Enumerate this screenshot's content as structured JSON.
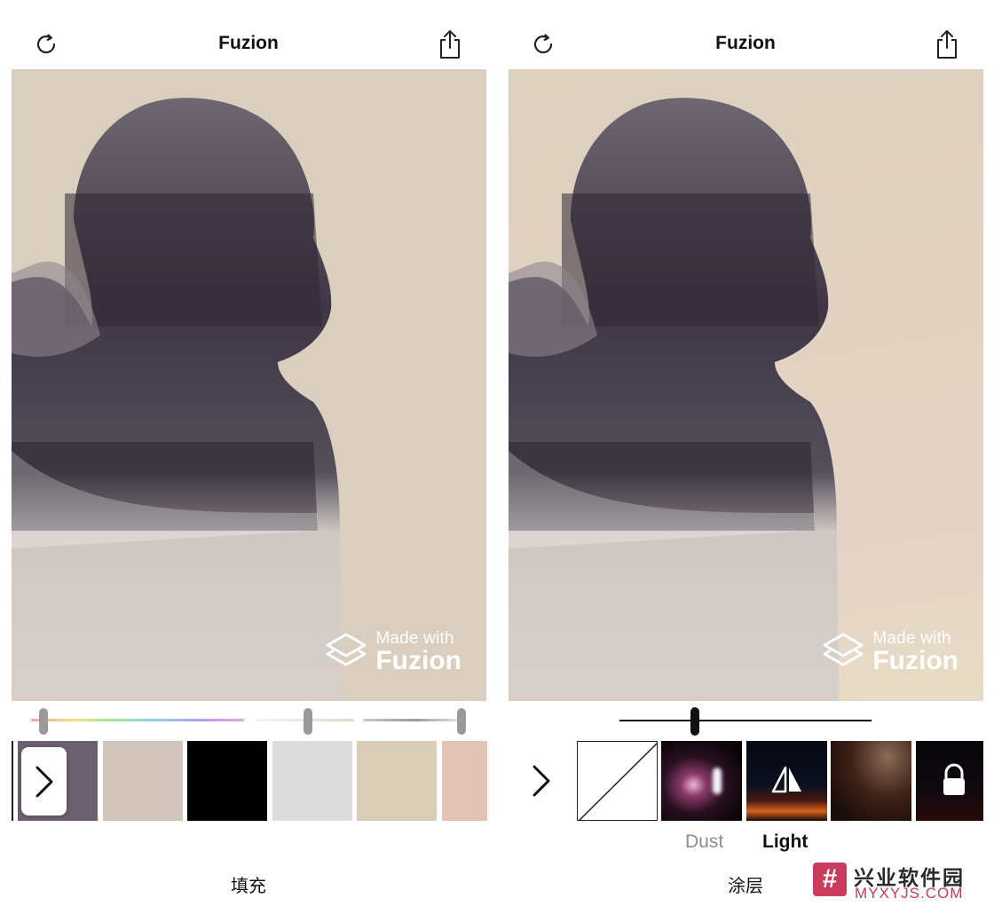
{
  "left_panel": {
    "title": "Fuzion",
    "refresh_icon": "refresh-icon",
    "share_icon": "share-icon",
    "watermark": {
      "line1": "Made with",
      "line2": "Fuzion"
    },
    "sliders": [
      {
        "name": "hue",
        "value": 0.06
      },
      {
        "name": "saturation",
        "value": 0.54
      },
      {
        "name": "brightness",
        "value": 0.96
      }
    ],
    "swatches": [
      "#6a6070",
      "#d2c5bc",
      "#000000",
      "#dcdcdc",
      "#d9cdb8",
      "#e2c3b6"
    ],
    "expand_icon": "chevron-right-icon",
    "bottom_label": "填充"
  },
  "right_panel": {
    "title": "Fuzion",
    "refresh_icon": "refresh-icon",
    "share_icon": "share-icon",
    "watermark": {
      "line1": "Made with",
      "line2": "Fuzion"
    },
    "opacity_slider": {
      "value": 0.3
    },
    "expand_icon": "chevron-right-icon",
    "textures": [
      {
        "name": "none",
        "icon": "none-icon"
      },
      {
        "name": "dust-texture"
      },
      {
        "name": "flip",
        "icon": "flip-icon"
      },
      {
        "name": "light-texture"
      },
      {
        "name": "locked",
        "icon": "lock-icon"
      }
    ],
    "categories": {
      "dust": "Dust",
      "light": "Light"
    },
    "bottom_label": "涂层"
  },
  "site_logo": {
    "mark": "#",
    "cn": "兴业软件园",
    "en": "MYXYJS.COM"
  },
  "colors": {
    "accent": "#111111",
    "logo": "#cb3b5e"
  }
}
